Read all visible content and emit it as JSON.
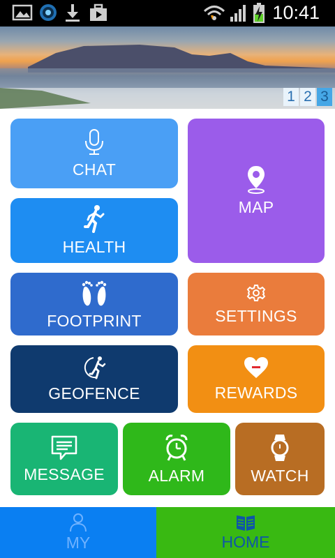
{
  "status_bar": {
    "time": "10:41",
    "icons": [
      "gallery-icon",
      "app-notification-icon",
      "download-icon",
      "briefcase-icon",
      "wifi-icon",
      "signal-icon",
      "battery-charging-icon"
    ]
  },
  "banner": {
    "pages": [
      "1",
      "2",
      "3"
    ],
    "active_page": "3"
  },
  "tiles": {
    "chat": {
      "label": "CHAT",
      "icon": "microphone-icon"
    },
    "map": {
      "label": "MAP",
      "icon": "map-pin-icon"
    },
    "health": {
      "label": "HEALTH",
      "icon": "runner-icon"
    },
    "footprint": {
      "label": "FOOTPRINT",
      "icon": "footprints-icon"
    },
    "settings": {
      "label": "SETTINGS",
      "icon": "gear-icon"
    },
    "geofence": {
      "label": "GEOFENCE",
      "icon": "geofence-runner-icon"
    },
    "rewards": {
      "label": "REWARDS",
      "icon": "heart-icon"
    },
    "message": {
      "label": "MESSAGE",
      "icon": "message-icon"
    },
    "alarm": {
      "label": "ALARM",
      "icon": "alarm-clock-icon"
    },
    "watch": {
      "label": "WATCH",
      "icon": "watch-icon"
    }
  },
  "nav": {
    "my": {
      "label": "MY",
      "icon": "person-icon"
    },
    "home": {
      "label": "HOME",
      "icon": "book-icon"
    }
  },
  "colors": {
    "chat": "#4a9ff5",
    "map": "#9b5cea",
    "health": "#1e8df2",
    "footprint": "#2f6bcd",
    "settings": "#ea7c3c",
    "geofence": "#0f3a6e",
    "rewards": "#f28f13",
    "message": "#19b574",
    "alarm": "#2fb81a",
    "watch": "#b86d23",
    "nav_my": "#0a7ff2",
    "nav_home": "#39b912"
  }
}
